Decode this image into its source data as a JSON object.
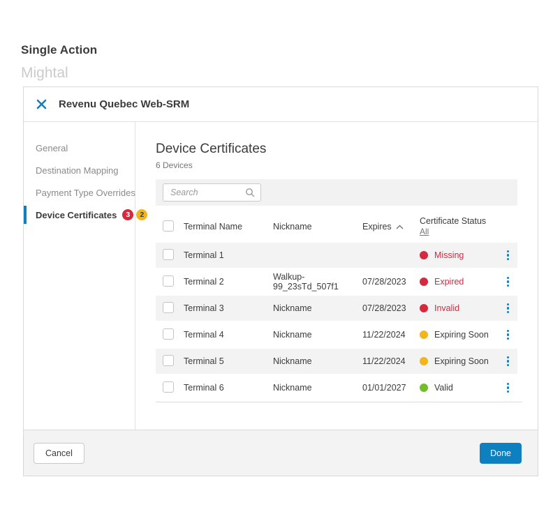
{
  "page": {
    "title": "Single Action",
    "app_name": "Mightal"
  },
  "modal": {
    "title": "Revenu Quebec Web-SRM",
    "sidebar": {
      "items": [
        {
          "label": "General",
          "selected": false
        },
        {
          "label": "Destination Mapping",
          "selected": false
        },
        {
          "label": "Payment Type Overrides",
          "selected": false
        },
        {
          "label": "Device Certificates",
          "selected": true,
          "badges": [
            {
              "value": "3",
              "color": "#d6283e"
            },
            {
              "value": "2",
              "color": "#f2b51d"
            }
          ]
        }
      ]
    },
    "content": {
      "heading": "Device Certificates",
      "device_count": "6 Devices",
      "search": {
        "placeholder": "Search"
      },
      "table": {
        "headers": {
          "terminal": "Terminal Name",
          "nickname": "Nickname",
          "expires": "Expires",
          "status": "Certificate Status",
          "status_filter": "All"
        },
        "sort": {
          "column": "Expires",
          "direction": "ascending"
        },
        "rows": [
          {
            "terminal": "Terminal 1",
            "nickname": "",
            "expires": "",
            "status": "Missing",
            "dot_color": "#d6283e",
            "status_text_color": "#d6283e"
          },
          {
            "terminal": "Terminal 2",
            "nickname": "Walkup-99_23sTd_507f1",
            "expires": "07/28/2023",
            "status": "Expired",
            "dot_color": "#d6283e",
            "status_text_color": "#d6283e"
          },
          {
            "terminal": "Terminal 3",
            "nickname": "Nickname",
            "expires": "07/28/2023",
            "status": "Invalid",
            "dot_color": "#d6283e",
            "status_text_color": "#d6283e"
          },
          {
            "terminal": "Terminal 4",
            "nickname": "Nickname",
            "expires": "11/22/2024",
            "status": "Expiring Soon",
            "dot_color": "#f2b51d",
            "status_text_color": "#3b3b3b"
          },
          {
            "terminal": "Terminal 5",
            "nickname": "Nickname",
            "expires": "11/22/2024",
            "status": "Expiring Soon",
            "dot_color": "#f2b51d",
            "status_text_color": "#3b3b3b"
          },
          {
            "terminal": "Terminal 6",
            "nickname": "Nickname",
            "expires": "01/01/2027",
            "status": "Valid",
            "dot_color": "#70bf25",
            "status_text_color": "#3b3b3b"
          }
        ]
      }
    },
    "footer": {
      "cancel_label": "Cancel",
      "done_label": "Done"
    }
  },
  "icons": {
    "close": "close-x-icon",
    "search": "search-icon",
    "sort": "sort-ascending-icon",
    "row_menu": "kebab-menu-icon"
  },
  "colors": {
    "accent_blue": "#0e80c0",
    "status_red": "#d6283e",
    "status_yellow": "#f2b51d",
    "status_green": "#70bf25"
  }
}
